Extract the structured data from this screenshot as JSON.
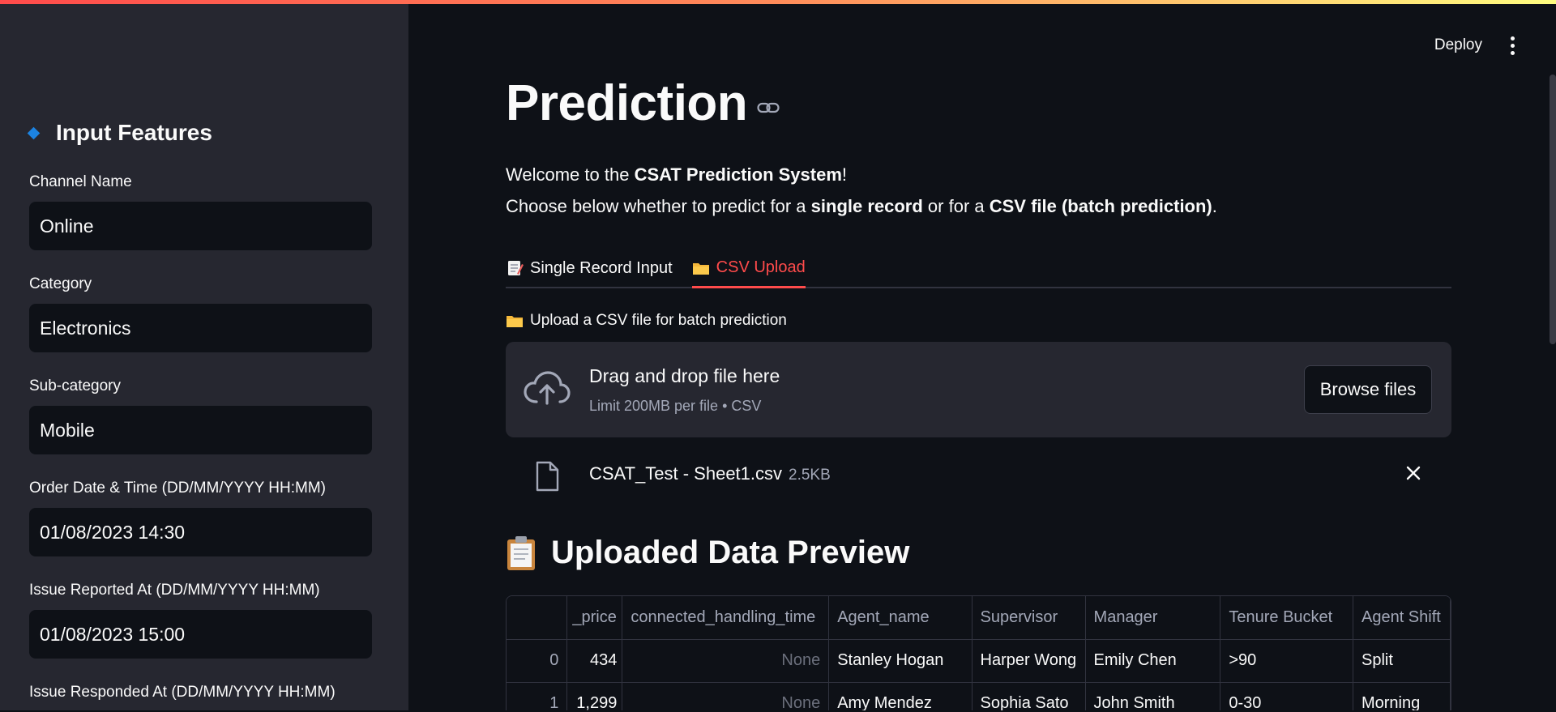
{
  "sidebar": {
    "title": "Input Features",
    "fields": [
      {
        "label": "Channel Name",
        "value": "Online"
      },
      {
        "label": "Category",
        "value": "Electronics"
      },
      {
        "label": "Sub-category",
        "value": "Mobile"
      },
      {
        "label": "Order Date & Time (DD/MM/YYYY HH:MM)",
        "value": "01/08/2023 14:30"
      },
      {
        "label": "Issue Reported At (DD/MM/YYYY HH:MM)",
        "value": "01/08/2023 15:00"
      },
      {
        "label": "Issue Responded At (DD/MM/YYYY HH:MM)",
        "value": ""
      }
    ]
  },
  "header": {
    "deploy_label": "Deploy"
  },
  "main": {
    "title": "Prediction",
    "intro_line1_a": "Welcome to the ",
    "intro_line1_b": "CSAT Prediction System",
    "intro_line1_c": "!",
    "intro_line2_a": "Choose below whether to predict for a ",
    "intro_line2_b": "single record",
    "intro_line2_c": " or for a ",
    "intro_line2_d": "CSV file (batch prediction)",
    "intro_line2_e": ".",
    "tabs": [
      {
        "label": "Single Record Input",
        "icon": "memo-emoji"
      },
      {
        "label": "CSV Upload",
        "icon": "folder-emoji",
        "active": true
      }
    ],
    "upload_label": "Upload a CSV file for batch prediction",
    "dropzone": {
      "title": "Drag and drop file here",
      "subtitle": "Limit 200MB per file • CSV",
      "browse_label": "Browse files"
    },
    "file": {
      "name": "CSAT_Test - Sheet1.csv",
      "size": "2.5KB"
    },
    "preview_title": "Uploaded Data Preview",
    "table": {
      "columns": [
        "",
        "_price",
        "connected_handling_time",
        "Agent_name",
        "Supervisor",
        "Manager",
        "Tenure Bucket",
        "Agent Shift"
      ],
      "rows": [
        [
          "0",
          "434",
          "None",
          "Stanley Hogan",
          "Harper Wong",
          "Emily Chen",
          ">90",
          "Split"
        ],
        [
          "1",
          "1,299",
          "None",
          "Amy Mendez",
          "Sophia Sato",
          "John Smith",
          "0-30",
          "Morning"
        ]
      ]
    }
  },
  "colors": {
    "accent": "#ff4b4b",
    "sidebar_bg": "#262730",
    "main_bg": "#0e1117"
  }
}
